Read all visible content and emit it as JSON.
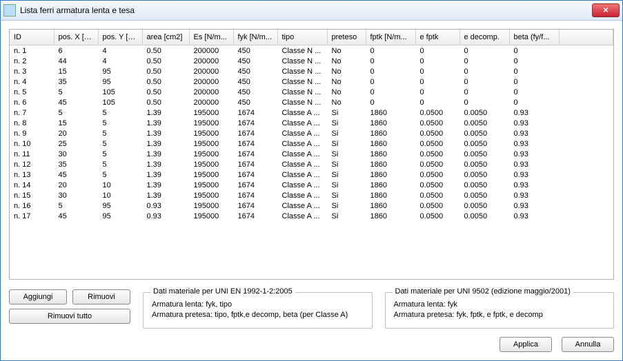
{
  "window": {
    "title": "Lista ferri armatura lenta e tesa"
  },
  "columns": [
    "ID",
    "pos. X [cm]",
    "pos. Y [cm]",
    "area [cm2]",
    "Es [N/m...",
    "fyk [N/m...",
    "tipo",
    "preteso",
    "fptk [N/m...",
    "e fptk",
    "e decomp.",
    "beta (fy/f...",
    ""
  ],
  "rows": [
    {
      "id": "n. 1",
      "px": "6",
      "py": "4",
      "area": "0.50",
      "es": "200000",
      "fyk": "450",
      "tipo": "Classe N ...",
      "pre": "No",
      "fptk": "0",
      "efptk": "0",
      "ede": "0",
      "beta": "0"
    },
    {
      "id": "n. 2",
      "px": "44",
      "py": "4",
      "area": "0.50",
      "es": "200000",
      "fyk": "450",
      "tipo": "Classe N ...",
      "pre": "No",
      "fptk": "0",
      "efptk": "0",
      "ede": "0",
      "beta": "0"
    },
    {
      "id": "n. 3",
      "px": "15",
      "py": "95",
      "area": "0.50",
      "es": "200000",
      "fyk": "450",
      "tipo": "Classe N ...",
      "pre": "No",
      "fptk": "0",
      "efptk": "0",
      "ede": "0",
      "beta": "0"
    },
    {
      "id": "n. 4",
      "px": "35",
      "py": "95",
      "area": "0.50",
      "es": "200000",
      "fyk": "450",
      "tipo": "Classe N ...",
      "pre": "No",
      "fptk": "0",
      "efptk": "0",
      "ede": "0",
      "beta": "0"
    },
    {
      "id": "n. 5",
      "px": "5",
      "py": "105",
      "area": "0.50",
      "es": "200000",
      "fyk": "450",
      "tipo": "Classe N ...",
      "pre": "No",
      "fptk": "0",
      "efptk": "0",
      "ede": "0",
      "beta": "0"
    },
    {
      "id": "n. 6",
      "px": "45",
      "py": "105",
      "area": "0.50",
      "es": "200000",
      "fyk": "450",
      "tipo": "Classe N ...",
      "pre": "No",
      "fptk": "0",
      "efptk": "0",
      "ede": "0",
      "beta": "0"
    },
    {
      "id": "n. 7",
      "px": "5",
      "py": "5",
      "area": "1.39",
      "es": "195000",
      "fyk": "1674",
      "tipo": "Classe A ...",
      "pre": "Si",
      "fptk": "1860",
      "efptk": "0.0500",
      "ede": "0.0050",
      "beta": "0.93"
    },
    {
      "id": "n. 8",
      "px": "15",
      "py": "5",
      "area": "1.39",
      "es": "195000",
      "fyk": "1674",
      "tipo": "Classe A ...",
      "pre": "Si",
      "fptk": "1860",
      "efptk": "0.0500",
      "ede": "0.0050",
      "beta": "0.93"
    },
    {
      "id": "n. 9",
      "px": "20",
      "py": "5",
      "area": "1.39",
      "es": "195000",
      "fyk": "1674",
      "tipo": "Classe A ...",
      "pre": "Si",
      "fptk": "1860",
      "efptk": "0.0500",
      "ede": "0.0050",
      "beta": "0.93"
    },
    {
      "id": "n. 10",
      "px": "25",
      "py": "5",
      "area": "1.39",
      "es": "195000",
      "fyk": "1674",
      "tipo": "Classe A ...",
      "pre": "Si",
      "fptk": "1860",
      "efptk": "0.0500",
      "ede": "0.0050",
      "beta": "0.93"
    },
    {
      "id": "n. 11",
      "px": "30",
      "py": "5",
      "area": "1.39",
      "es": "195000",
      "fyk": "1674",
      "tipo": "Classe A ...",
      "pre": "Si",
      "fptk": "1860",
      "efptk": "0.0500",
      "ede": "0.0050",
      "beta": "0.93"
    },
    {
      "id": "n. 12",
      "px": "35",
      "py": "5",
      "area": "1.39",
      "es": "195000",
      "fyk": "1674",
      "tipo": "Classe A ...",
      "pre": "Si",
      "fptk": "1860",
      "efptk": "0.0500",
      "ede": "0.0050",
      "beta": "0.93"
    },
    {
      "id": "n. 13",
      "px": "45",
      "py": "5",
      "area": "1.39",
      "es": "195000",
      "fyk": "1674",
      "tipo": "Classe A ...",
      "pre": "Si",
      "fptk": "1860",
      "efptk": "0.0500",
      "ede": "0.0050",
      "beta": "0.93"
    },
    {
      "id": "n. 14",
      "px": "20",
      "py": "10",
      "area": "1.39",
      "es": "195000",
      "fyk": "1674",
      "tipo": "Classe A ...",
      "pre": "Si",
      "fptk": "1860",
      "efptk": "0.0500",
      "ede": "0.0050",
      "beta": "0.93"
    },
    {
      "id": "n. 15",
      "px": "30",
      "py": "10",
      "area": "1.39",
      "es": "195000",
      "fyk": "1674",
      "tipo": "Classe A ...",
      "pre": "Si",
      "fptk": "1860",
      "efptk": "0.0500",
      "ede": "0.0050",
      "beta": "0.93"
    },
    {
      "id": "n. 16",
      "px": "5",
      "py": "95",
      "area": "0.93",
      "es": "195000",
      "fyk": "1674",
      "tipo": "Classe A ...",
      "pre": "Si",
      "fptk": "1860",
      "efptk": "0.0500",
      "ede": "0.0050",
      "beta": "0.93"
    },
    {
      "id": "n. 17",
      "px": "45",
      "py": "95",
      "area": "0.93",
      "es": "195000",
      "fyk": "1674",
      "tipo": "Classe A ...",
      "pre": "Si",
      "fptk": "1860",
      "efptk": "0.0500",
      "ede": "0.0050",
      "beta": "0.93"
    }
  ],
  "buttons": {
    "add": "Aggiungi",
    "remove": "Rimuovi",
    "remove_all": "Rimuovi tutto",
    "apply": "Applica",
    "cancel": "Annulla"
  },
  "box1": {
    "title": "Dati materiale per UNI EN 1992-1-2:2005",
    "l1": "Armatura lenta: fyk, tipo",
    "l2": "Armatura pretesa: tipo, fptk,e decomp, beta (per Classe A)"
  },
  "box2": {
    "title": "Dati materiale per UNI 9502 (edizione maggio/2001)",
    "l1": "Armatura lenta: fyk",
    "l2": "Armatura pretesa: fyk, fptk, e fptk, e decomp"
  }
}
